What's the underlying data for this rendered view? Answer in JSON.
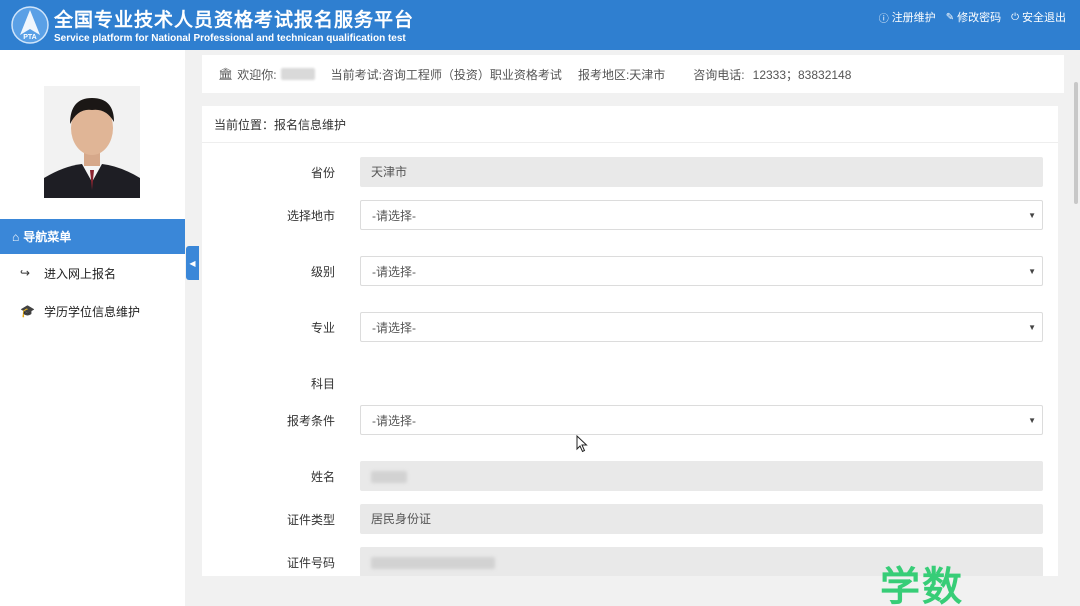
{
  "header": {
    "title": "全国专业技术人员资格考试报名服务平台",
    "subtitle": "Service platform for National Professional and technican qualification test",
    "logo_text": "PTA",
    "links": [
      {
        "icon": "info-icon",
        "label": "注册维护"
      },
      {
        "icon": "edit-icon",
        "label": "修改密码"
      },
      {
        "icon": "power-icon",
        "label": "安全退出"
      }
    ]
  },
  "sidebar": {
    "nav_header": "导航菜单",
    "items": [
      {
        "icon": "share-arrow-icon",
        "label": "进入网上报名"
      },
      {
        "icon": "graduation-cap-icon",
        "label": "学历学位信息维护"
      }
    ]
  },
  "infobar": {
    "welcome": "欢迎你:",
    "exam_label": "当前考试:",
    "exam_value": "咨询工程师（投资）职业资格考试",
    "region_label": "报考地区:",
    "region_value": "天津市",
    "phone_label": "咨询电话:",
    "phone_value": "12333；83832148"
  },
  "breadcrumb": "当前位置：报名信息维护",
  "form": {
    "province": {
      "label": "省份",
      "value": "天津市"
    },
    "city": {
      "label": "选择地市",
      "value": "-请选择-"
    },
    "level": {
      "label": "级别",
      "value": "-请选择-"
    },
    "major": {
      "label": "专业",
      "value": "-请选择-"
    },
    "subject": {
      "label": "科目"
    },
    "condition": {
      "label": "报考条件",
      "value": "-请选择-"
    },
    "name": {
      "label": "姓名"
    },
    "id_type": {
      "label": "证件类型",
      "value": "居民身份证"
    },
    "id_number": {
      "label": "证件号码"
    }
  },
  "watermark": "学数",
  "colors": {
    "header": "#2f7fd0",
    "nav_active": "#3a87d8",
    "watermark": "#2ecc71"
  }
}
